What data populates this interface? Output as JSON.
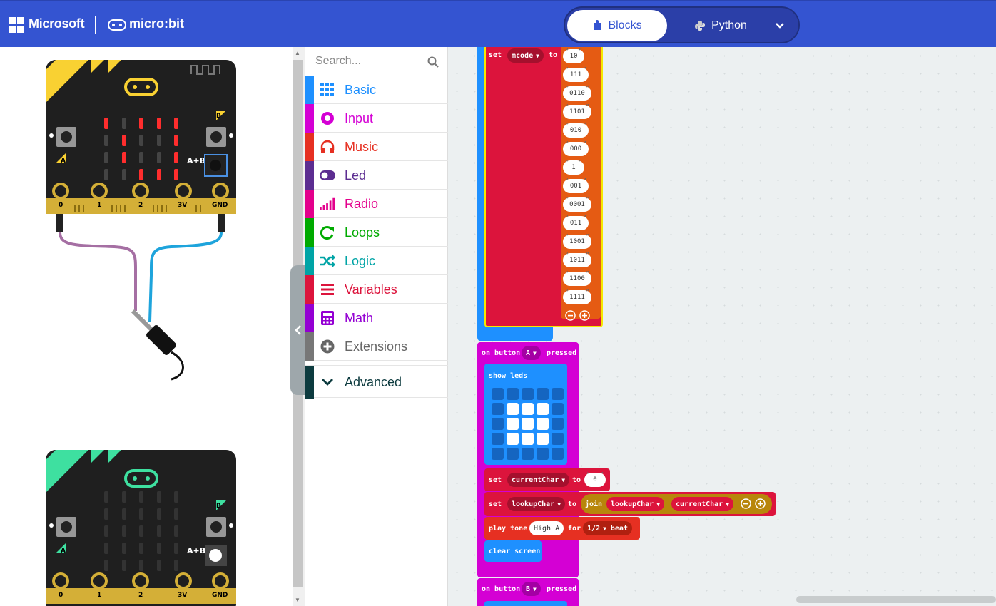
{
  "header": {
    "brand": "Microsoft",
    "product": "micro:bit",
    "modes": [
      {
        "label": "Blocks",
        "active": true
      },
      {
        "label": "Python",
        "active": false
      }
    ],
    "more_icon": "chevron-down-icon"
  },
  "simulator": {
    "board1": {
      "buttons": [
        "A",
        "B",
        "A+B"
      ],
      "pins": [
        "0",
        "1",
        "2",
        "3V",
        "GND"
      ],
      "accent": "#f9d132"
    },
    "board2": {
      "buttons": [
        "A",
        "B",
        "A+B"
      ],
      "pins": [
        "0",
        "1",
        "2",
        "3V",
        "GND"
      ],
      "accent": "#3ee0a0"
    }
  },
  "toolbox": {
    "search_placeholder": "Search...",
    "categories": [
      {
        "label": "Basic",
        "color": "#1e90ff",
        "icon": "grid-icon"
      },
      {
        "label": "Input",
        "color": "#d400d4",
        "icon": "circle-dot-icon"
      },
      {
        "label": "Music",
        "color": "#e63022",
        "icon": "headphones-icon"
      },
      {
        "label": "Led",
        "color": "#5c2d91",
        "icon": "toggle-icon"
      },
      {
        "label": "Radio",
        "color": "#e3008c",
        "icon": "signal-bars-icon"
      },
      {
        "label": "Loops",
        "color": "#00aa00",
        "icon": "refresh-icon"
      },
      {
        "label": "Logic",
        "color": "#00a4a6",
        "icon": "shuffle-icon"
      },
      {
        "label": "Variables",
        "color": "#dc143c",
        "icon": "lines-icon"
      },
      {
        "label": "Math",
        "color": "#9400d3",
        "icon": "calculator-icon"
      },
      {
        "label": "Extensions",
        "color": "#777777",
        "icon": "plus-circle-icon"
      },
      {
        "label": "Advanced",
        "color": "#0d3b3f",
        "icon": "chevron-down-icon"
      }
    ]
  },
  "workspace": {
    "set_block": {
      "keyword": "set",
      "variable": "mcode",
      "to": "to"
    },
    "mcode_values": [
      "10",
      "111",
      "0110",
      "1101",
      "010",
      "000",
      "1",
      "001",
      "0001",
      "011",
      "1001",
      "1011",
      "1100",
      "1111"
    ],
    "on_button_a": {
      "prefix": "on button",
      "button": "A",
      "suffix": "pressed"
    },
    "show_leds": "show leds",
    "set_current": {
      "keyword": "set",
      "variable": "currentChar",
      "to": "to",
      "value": "0"
    },
    "set_lookup": {
      "keyword": "set",
      "variable": "lookupChar",
      "to": "to",
      "join": "join",
      "arg1": "lookupChar",
      "arg2": "currentChar"
    },
    "play_tone": {
      "keyword": "play tone",
      "note": "High A",
      "for": "for",
      "duration": "1/2",
      "beat": "beat"
    },
    "clear_screen": "clear screen",
    "on_button_b": {
      "prefix": "on button",
      "button": "B",
      "suffix": "pressed"
    }
  }
}
